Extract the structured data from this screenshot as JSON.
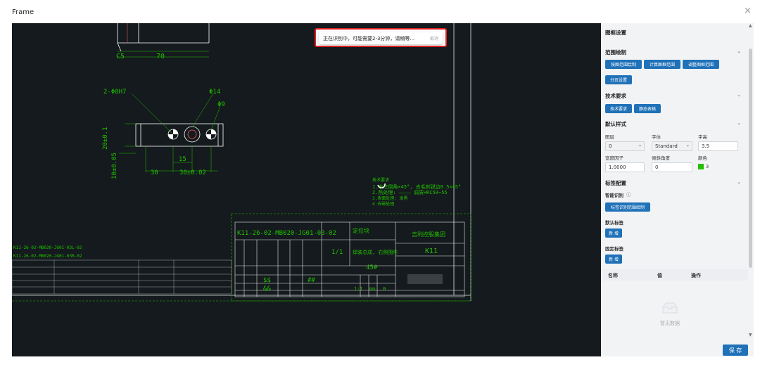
{
  "window": {
    "title": "Frame",
    "close_glyph": "×"
  },
  "toast": {
    "message": "正在识别中，可能需要2-3分钟，请稍等...",
    "cancel": "取消"
  },
  "drawing": {
    "dims": [
      "C5",
      "70",
      "2-Φ8H7",
      "Φ14",
      "Φ9",
      "20±0.1",
      "10±0.05",
      "15",
      "30",
      "30±0.02"
    ],
    "tech_title": "技术要求",
    "tech_lines": [
      "1.未注倒角×45°, 去毛刺锐边0.5×45°",
      "2.热处理: ———— 调质HRC50~55",
      "3.表面处理: 发黑",
      "4.去磁处理"
    ],
    "title_block": {
      "drawing_no": "K11-26-02-MB020-JG01-03-02",
      "part_name": "定位块",
      "company": "吉利控股集团",
      "project": "K11",
      "qty": "1/1",
      "assembly": "焊装总成, 右侧围件",
      "material": "45#",
      "scale": "1:1",
      "unit": "mm",
      "sheet": "0",
      "vals": [
        "$$",
        "&&",
        "##"
      ],
      "left_lines": [
        "K11-26-02-MB020-JG01-03L-02",
        "K11-26-02-MB020-JG01-03R-02"
      ]
    }
  },
  "panel": {
    "title": "图框设置",
    "range": {
      "title": "范围绘制",
      "buttons": [
        "按图范围绘制",
        "计算图框范围",
        "调整图框范围",
        "分页设置"
      ]
    },
    "tech": {
      "title": "技术要求",
      "buttons": [
        "技术要求",
        "静态表格"
      ]
    },
    "style": {
      "title": "默认样式",
      "layer_label": "图层",
      "layer_value": "0",
      "font_label": "字体",
      "font_value": "Standard",
      "height_label": "字高",
      "height_value": "3.5",
      "width_label": "宽度因子",
      "width_value": "1.0000",
      "angle_label": "倾斜角度",
      "angle_value": "0",
      "color_label": "颜色",
      "color_value": "3",
      "color_hex": "#22c000"
    },
    "label": {
      "title": "标签配置",
      "smart_label": "智能识别",
      "smart_button": "标签识别范围绘制",
      "default_label": "默认标签",
      "fixed_label": "固定标签",
      "add": "新 增"
    },
    "table": {
      "headers": [
        "名称",
        "值",
        "操作"
      ],
      "empty": "暂无数据"
    },
    "save": "保 存"
  },
  "colors": {
    "accent": "#1f71b8",
    "canvas": "#141a1d",
    "toast_border": "#e02020"
  }
}
